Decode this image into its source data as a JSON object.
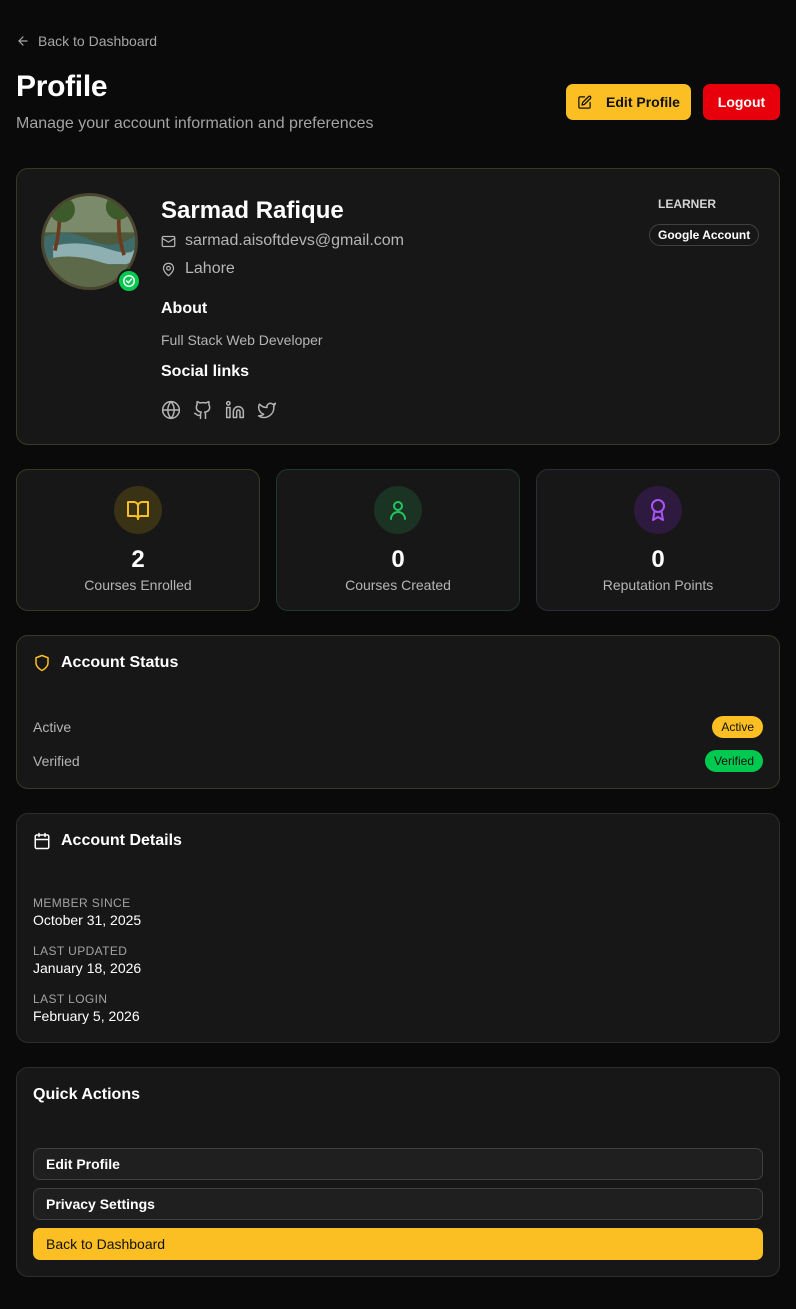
{
  "header": {
    "back_label": "Back to Dashboard",
    "title": "Profile",
    "subtitle": "Manage your account information and preferences",
    "edit_label": "Edit Profile",
    "logout_label": "Logout"
  },
  "profile": {
    "name": "Sarmad Rafique",
    "email": "sarmad.aisoftdevs@gmail.com",
    "location": "Lahore",
    "about_heading": "About",
    "about_text": "Full Stack Web Developer",
    "social_heading": "Social links",
    "social_icons": [
      "globe-icon",
      "github-icon",
      "linkedin-icon",
      "twitter-icon"
    ],
    "role": "LEARNER",
    "account_type": "Google Account"
  },
  "stats": [
    {
      "value": "2",
      "label": "Courses Enrolled",
      "icon": "book-open-icon",
      "color": "#fbbf24"
    },
    {
      "value": "0",
      "label": "Courses Created",
      "icon": "user-icon",
      "color": "#22c55e"
    },
    {
      "value": "0",
      "label": "Reputation Points",
      "icon": "award-icon",
      "color": "#a855f7"
    }
  ],
  "account_status": {
    "title": "Account Status",
    "rows": [
      {
        "label": "Active",
        "badge": "Active"
      },
      {
        "label": "Verified",
        "badge": "Verified"
      }
    ]
  },
  "account_details": {
    "title": "Account Details",
    "items": [
      {
        "label": "MEMBER SINCE",
        "value": "October 31, 2025"
      },
      {
        "label": "LAST UPDATED",
        "value": "January 18, 2026"
      },
      {
        "label": "LAST LOGIN",
        "value": "February 5, 2026"
      }
    ]
  },
  "quick_actions": {
    "title": "Quick Actions",
    "buttons": [
      "Edit Profile",
      "Privacy Settings",
      "Back to Dashboard"
    ]
  },
  "colors": {
    "accent": "#fbbf24",
    "danger": "#e7000b",
    "success": "#00c950",
    "background": "#0a0a0a",
    "card": "#171717"
  }
}
